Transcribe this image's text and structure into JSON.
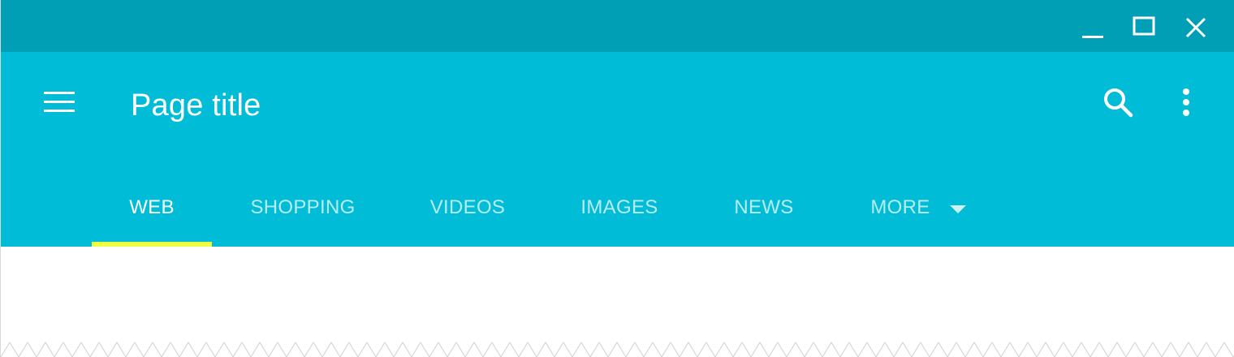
{
  "window": {
    "controls": {
      "minimize_icon": "minimize-icon",
      "maximize_icon": "maximize-icon",
      "close_icon": "close-icon"
    }
  },
  "appbar": {
    "menu_icon": "menu-icon",
    "title": "Page title",
    "search_icon": "search-icon",
    "more_vert_icon": "more-vert-icon"
  },
  "tabs": [
    {
      "label": "WEB",
      "active": true
    },
    {
      "label": "SHOPPING",
      "active": false
    },
    {
      "label": "VIDEOS",
      "active": false
    },
    {
      "label": "IMAGES",
      "active": false
    },
    {
      "label": "NEWS",
      "active": false
    },
    {
      "label": "MORE",
      "active": false,
      "dropdown_icon": "arrow-drop-down-icon"
    }
  ],
  "colors": {
    "titlebar": "#009fb6",
    "appbar": "#00bcd6",
    "indicator": "#eeff41",
    "content": "#ffffff"
  }
}
